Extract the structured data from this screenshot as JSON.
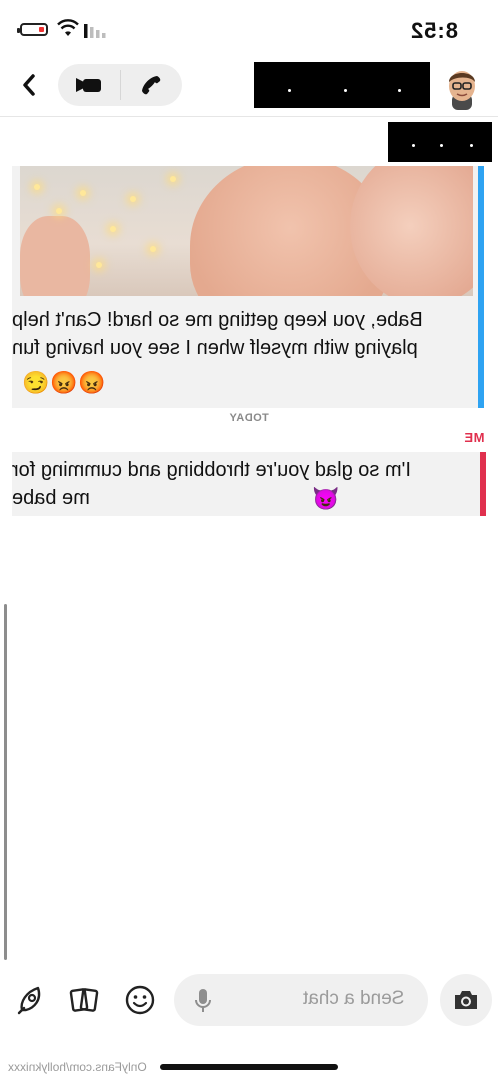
{
  "status": {
    "time": "8:52",
    "battery_color": "#e33333"
  },
  "header": {
    "back_icon": "chevron-left-icon",
    "video_icon": "video-camera-icon",
    "phone_icon": "phone-icon"
  },
  "messages": [
    {
      "text": "Babe, you keep getting me so hard! Can't help playing with myself when I see you having fun",
      "emojis": [
        "😡",
        "😡",
        "😏"
      ],
      "accent": "#2ea3f2",
      "has_image": true
    },
    {
      "sender_label": "ME",
      "text": "I'm so glad you're throbbing and cumming for me babe",
      "emoji": "😈",
      "accent": "#e0304e"
    }
  ],
  "divider": {
    "label": "TODAY"
  },
  "composer": {
    "placeholder": "Send a chat"
  },
  "watermark": "OnlyFans.com/hollyknixxx"
}
